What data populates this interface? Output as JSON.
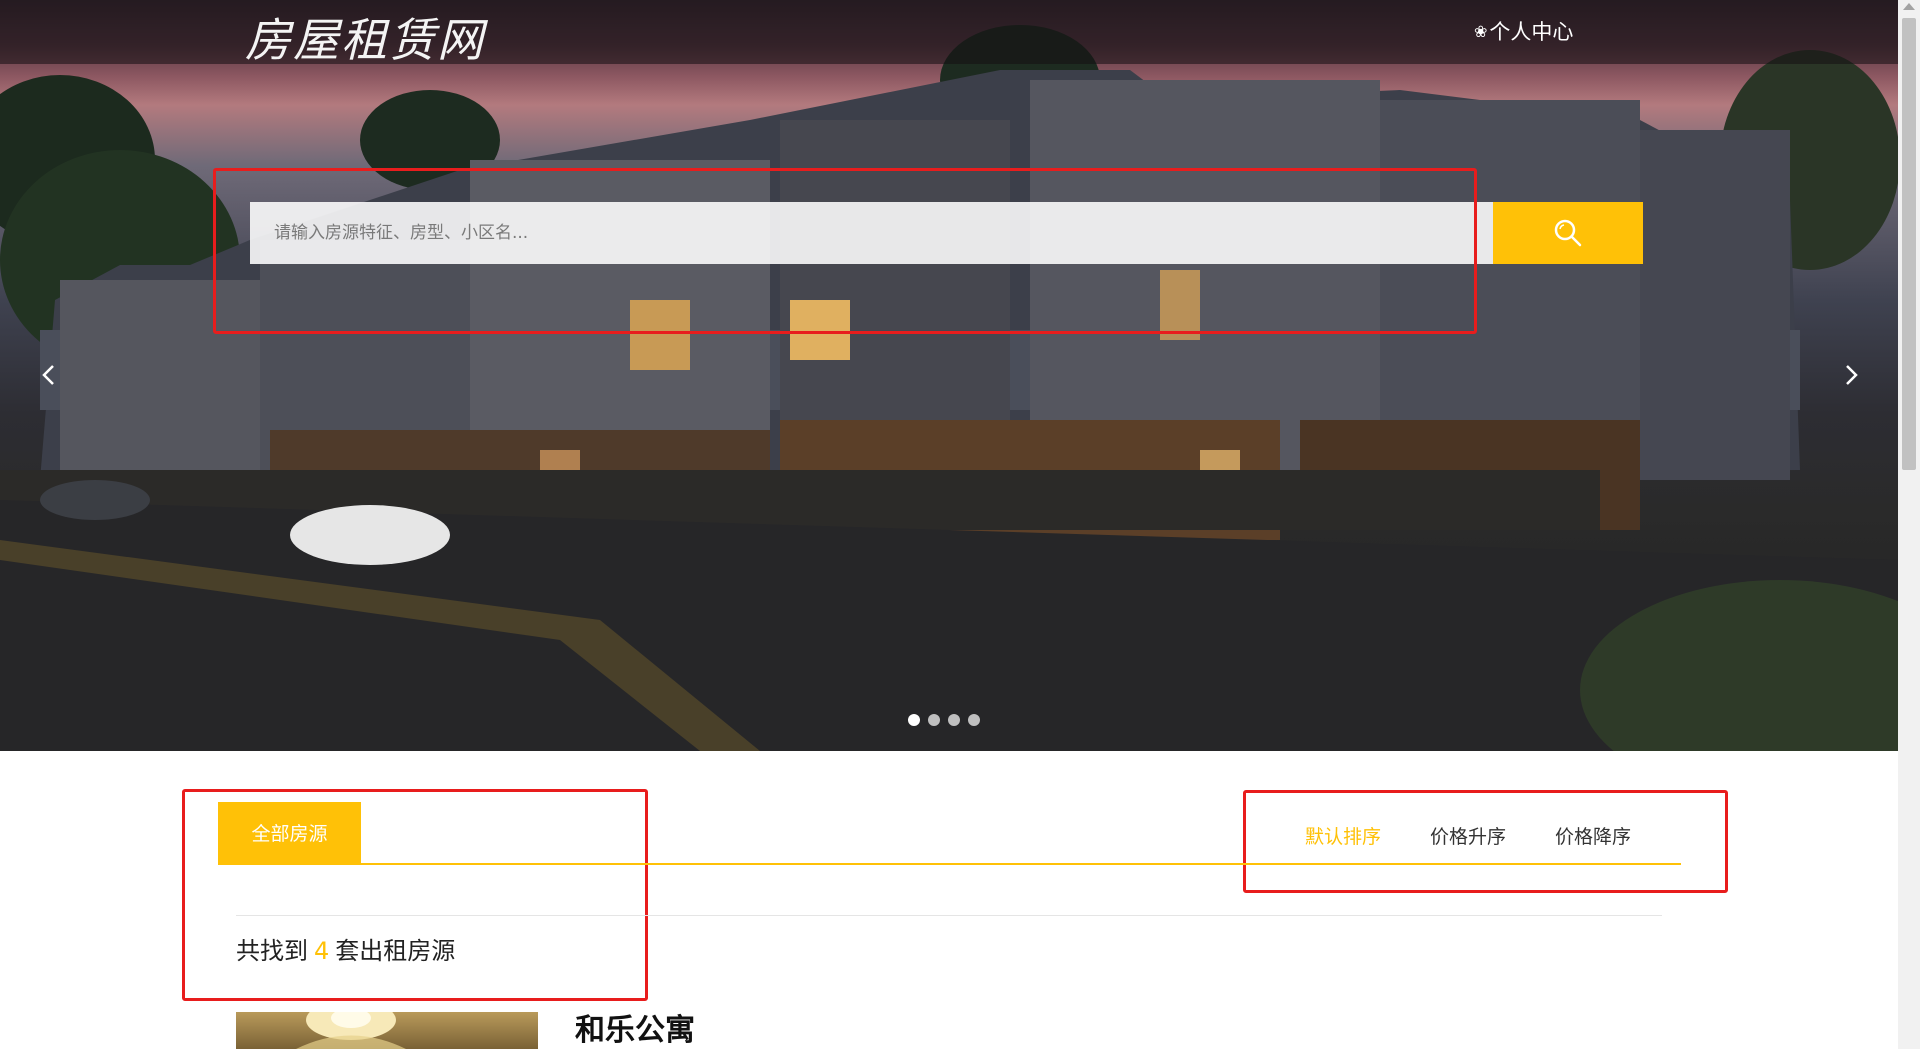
{
  "header": {
    "logo_text": "房屋租赁网",
    "user_center_icon": "leaf-icon",
    "user_center_label": "个人中心"
  },
  "search": {
    "placeholder": "请输入房源特征、房型、小区名...",
    "button_icon": "search-icon"
  },
  "carousel": {
    "prev_icon": "chevron-left-icon",
    "next_icon": "chevron-right-icon",
    "slide_count": 4,
    "active_index": 0
  },
  "tabs": {
    "all_listings": "全部房源"
  },
  "sort": {
    "default": "默认排序",
    "price_asc": "价格升序",
    "price_desc": "价格降序",
    "active": "default"
  },
  "results": {
    "prefix": "共找到",
    "count": "4",
    "suffix": "套出租房源"
  },
  "listings": [
    {
      "title": "和乐公寓"
    }
  ],
  "colors": {
    "accent": "#ffc107",
    "highlight_box": "#e81d1d"
  }
}
